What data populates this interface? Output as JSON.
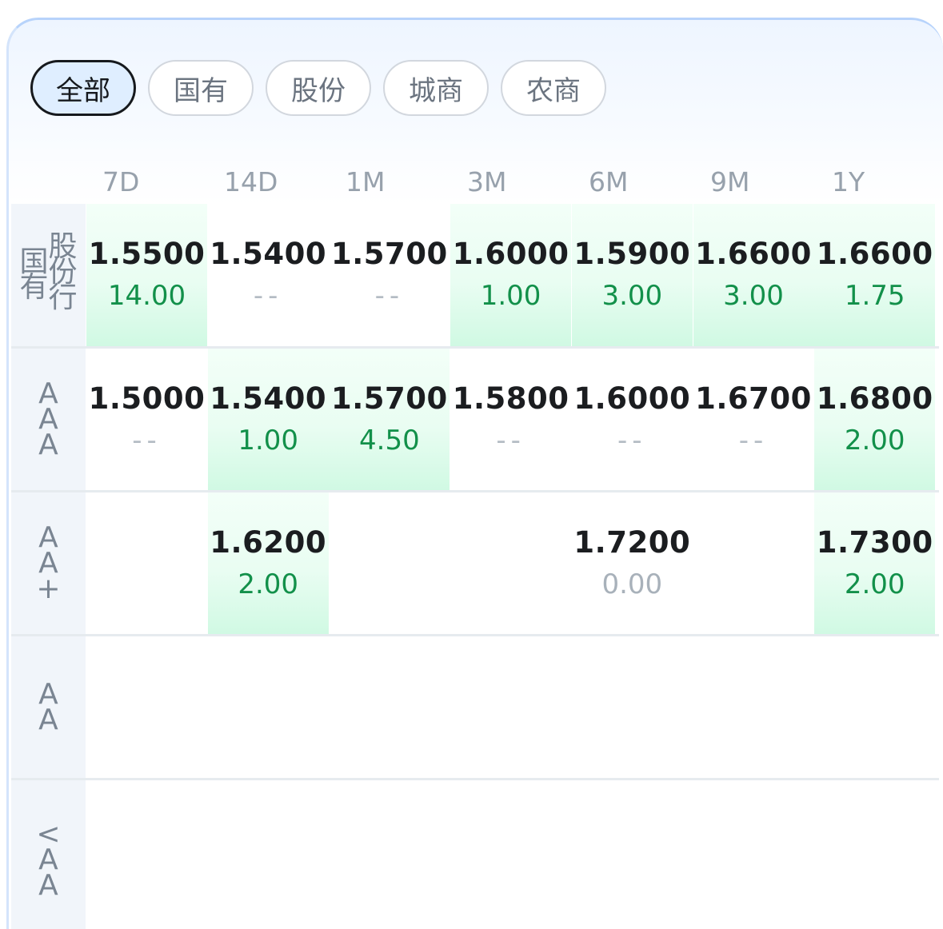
{
  "tabs": [
    "全部",
    "国有",
    "股份",
    "城商",
    "农商"
  ],
  "active_tab": "全部",
  "columns": [
    "7D",
    "14D",
    "1M",
    "3M",
    "6M",
    "9M",
    "1Y"
  ],
  "rows": [
    {
      "label_left": "国有",
      "label_right": "股份行",
      "cells": [
        {
          "rate": "1.5500",
          "vol": "14.00",
          "state": "hl"
        },
        {
          "rate": "1.5400",
          "vol": "--",
          "state": ""
        },
        {
          "rate": "1.5700",
          "vol": "--",
          "state": ""
        },
        {
          "rate": "1.6000",
          "vol": "1.00",
          "state": "hl"
        },
        {
          "rate": "1.5900",
          "vol": "3.00",
          "state": "hl"
        },
        {
          "rate": "1.6600",
          "vol": "3.00",
          "state": "hl"
        },
        {
          "rate": "1.6600",
          "vol": "1.75",
          "state": "hl"
        }
      ]
    },
    {
      "label": "AAA",
      "cells": [
        {
          "rate": "1.5000",
          "vol": "--",
          "state": ""
        },
        {
          "rate": "1.5400",
          "vol": "1.00",
          "state": "hl"
        },
        {
          "rate": "1.5700",
          "vol": "4.50",
          "state": "hl"
        },
        {
          "rate": "1.5800",
          "vol": "--",
          "state": ""
        },
        {
          "rate": "1.6000",
          "vol": "--",
          "state": ""
        },
        {
          "rate": "1.6700",
          "vol": "--",
          "state": ""
        },
        {
          "rate": "1.6800",
          "vol": "2.00",
          "state": "hl"
        }
      ]
    },
    {
      "label": "AA+",
      "cells": [
        {
          "rate": "",
          "vol": "",
          "state": ""
        },
        {
          "rate": "1.6200",
          "vol": "2.00",
          "state": "hl"
        },
        {
          "rate": "",
          "vol": "",
          "state": ""
        },
        {
          "rate": "",
          "vol": "",
          "state": ""
        },
        {
          "rate": "1.7200",
          "vol": "0.00",
          "state": "zero"
        },
        {
          "rate": "",
          "vol": "",
          "state": ""
        },
        {
          "rate": "1.7300",
          "vol": "2.00",
          "state": "hl"
        }
      ]
    },
    {
      "label": "AA",
      "cells": []
    },
    {
      "label": "<AA",
      "cells": []
    }
  ],
  "colors": {
    "highlight_green": "#12904a",
    "active_tab_bg": "#dfeeff",
    "rate_text": "#1b1d20",
    "header_text": "#97a1ac"
  }
}
